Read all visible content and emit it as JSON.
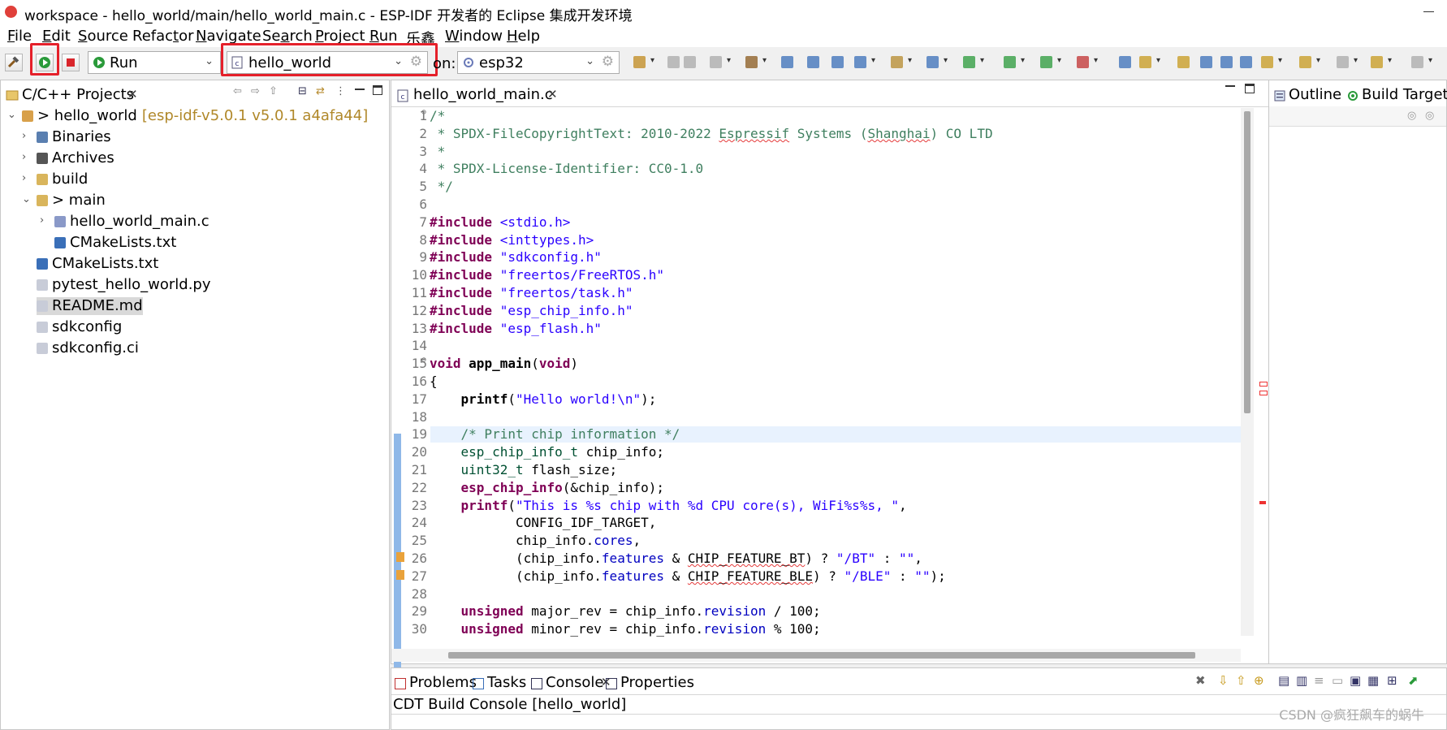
{
  "window": {
    "title": "workspace - hello_world/main/hello_world_main.c - ESP-IDF 开发者的 Eclipse 集成开发环境"
  },
  "menu": [
    {
      "pre": "",
      "u": "F",
      "post": "ile"
    },
    {
      "pre": "",
      "u": "E",
      "post": "dit"
    },
    {
      "pre": "",
      "u": "S",
      "post": "ource"
    },
    {
      "pre": "Refac",
      "u": "t",
      "post": "or"
    },
    {
      "pre": "",
      "u": "N",
      "post": "avigate"
    },
    {
      "pre": "Se",
      "u": "a",
      "post": "rch"
    },
    {
      "pre": "",
      "u": "P",
      "post": "roject"
    },
    {
      "pre": "",
      "u": "R",
      "post": "un"
    },
    {
      "pre": "乐鑫",
      "u": "",
      "post": ""
    },
    {
      "pre": "",
      "u": "W",
      "post": "indow"
    },
    {
      "pre": "",
      "u": "H",
      "post": "elp"
    }
  ],
  "toolbar": {
    "launch_mode": "Run",
    "launch_config": "hello_world",
    "target_label": "on:",
    "target": "esp32"
  },
  "project_explorer": {
    "tab_label": "C/C++ Projects",
    "project_name": "> hello_world",
    "project_decoration": "[esp-idf-v5.0.1 v5.0.1 a4afa44]",
    "items": [
      {
        "label": "Binaries"
      },
      {
        "label": "Archives"
      },
      {
        "label": "build"
      },
      {
        "label": "> main"
      },
      {
        "label": "hello_world_main.c"
      },
      {
        "label": "CMakeLists.txt"
      },
      {
        "label": "CMakeLists.txt"
      },
      {
        "label": "pytest_hello_world.py"
      },
      {
        "label": "README.md"
      },
      {
        "label": "sdkconfig"
      },
      {
        "label": "sdkconfig.ci"
      }
    ]
  },
  "editor": {
    "tab_label": "hello_world_main.c",
    "lines": [
      {
        "n": "1",
        "s": [
          {
            "c": "cm",
            "t": "/*"
          }
        ]
      },
      {
        "n": "2",
        "s": [
          {
            "c": "cm",
            "t": " * SPDX-FileCopyrightText: 2010-2022 "
          },
          {
            "c": "cm sq",
            "t": "Espressif"
          },
          {
            "c": "cm",
            "t": " Systems ("
          },
          {
            "c": "cm sq",
            "t": "Shanghai"
          },
          {
            "c": "cm",
            "t": ") CO LTD"
          }
        ]
      },
      {
        "n": "3",
        "s": [
          {
            "c": "cm",
            "t": " *"
          }
        ]
      },
      {
        "n": "4",
        "s": [
          {
            "c": "cm",
            "t": " * SPDX-License-Identifier: CC0-1.0"
          }
        ]
      },
      {
        "n": "5",
        "s": [
          {
            "c": "cm",
            "t": " */"
          }
        ]
      },
      {
        "n": "6",
        "s": []
      },
      {
        "n": "7",
        "s": [
          {
            "c": "kw",
            "t": "#include"
          },
          {
            "c": "",
            "t": " "
          },
          {
            "c": "st",
            "t": "<stdio.h>"
          }
        ]
      },
      {
        "n": "8",
        "s": [
          {
            "c": "kw",
            "t": "#include"
          },
          {
            "c": "",
            "t": " "
          },
          {
            "c": "st",
            "t": "<inttypes.h>"
          }
        ]
      },
      {
        "n": "9",
        "s": [
          {
            "c": "kw",
            "t": "#include"
          },
          {
            "c": "",
            "t": " "
          },
          {
            "c": "st",
            "t": "\"sdkconfig.h\""
          }
        ]
      },
      {
        "n": "10",
        "s": [
          {
            "c": "kw",
            "t": "#include"
          },
          {
            "c": "",
            "t": " "
          },
          {
            "c": "st",
            "t": "\"freertos/FreeRTOS.h\""
          }
        ]
      },
      {
        "n": "11",
        "s": [
          {
            "c": "kw",
            "t": "#include"
          },
          {
            "c": "",
            "t": " "
          },
          {
            "c": "st",
            "t": "\"freertos/task.h\""
          }
        ]
      },
      {
        "n": "12",
        "s": [
          {
            "c": "kw",
            "t": "#include"
          },
          {
            "c": "",
            "t": " "
          },
          {
            "c": "st",
            "t": "\"esp_chip_info.h\""
          }
        ]
      },
      {
        "n": "13",
        "s": [
          {
            "c": "kw",
            "t": "#include"
          },
          {
            "c": "",
            "t": " "
          },
          {
            "c": "st",
            "t": "\"esp_flash.h\""
          }
        ]
      },
      {
        "n": "14",
        "s": []
      },
      {
        "n": "15",
        "s": [
          {
            "c": "kw",
            "t": "void"
          },
          {
            "c": "",
            "t": " "
          },
          {
            "c": "fn",
            "t": "app_main"
          },
          {
            "c": "",
            "t": "("
          },
          {
            "c": "kw",
            "t": "void"
          },
          {
            "c": "",
            "t": ")"
          }
        ]
      },
      {
        "n": "16",
        "s": [
          {
            "c": "",
            "t": "{"
          }
        ]
      },
      {
        "n": "17",
        "s": [
          {
            "c": "",
            "t": "    "
          },
          {
            "c": "fn kw",
            "t": "printf"
          },
          {
            "c": "",
            "t": "("
          },
          {
            "c": "st",
            "t": "\"Hello world!\\n\""
          },
          {
            "c": "",
            "t": ");"
          }
        ]
      },
      {
        "n": "18",
        "s": []
      },
      {
        "n": "19",
        "s": [
          {
            "c": "",
            "t": "    "
          },
          {
            "c": "cm",
            "t": "/* Print chip information */"
          }
        ]
      },
      {
        "n": "20",
        "s": [
          {
            "c": "",
            "t": "    "
          },
          {
            "c": "ty",
            "t": "esp_chip_info_t"
          },
          {
            "c": "",
            "t": " chip_info;"
          }
        ]
      },
      {
        "n": "21",
        "s": [
          {
            "c": "",
            "t": "    "
          },
          {
            "c": "ty",
            "t": "uint32_t"
          },
          {
            "c": "",
            "t": " flash_size;"
          }
        ]
      },
      {
        "n": "22",
        "s": [
          {
            "c": "",
            "t": "    "
          },
          {
            "c": "kw",
            "t": "esp_chip_info"
          },
          {
            "c": "",
            "t": "(&chip_info);"
          }
        ]
      },
      {
        "n": "23",
        "s": [
          {
            "c": "",
            "t": "    "
          },
          {
            "c": "kw",
            "t": "printf"
          },
          {
            "c": "",
            "t": "("
          },
          {
            "c": "st",
            "t": "\"This is %s chip with %d CPU core(s), WiFi%s%s, \""
          },
          {
            "c": "",
            "t": ","
          }
        ]
      },
      {
        "n": "24",
        "s": [
          {
            "c": "",
            "t": "           CONFIG_IDF_TARGET,"
          }
        ]
      },
      {
        "n": "25",
        "s": [
          {
            "c": "",
            "t": "           chip_info."
          },
          {
            "c": "fld",
            "t": "cores"
          },
          {
            "c": "",
            "t": ","
          }
        ]
      },
      {
        "n": "26",
        "s": [
          {
            "c": "",
            "t": "           (chip_info."
          },
          {
            "c": "fld",
            "t": "features"
          },
          {
            "c": "",
            "t": " & "
          },
          {
            "c": "sq",
            "t": "CHIP_FEATURE_BT"
          },
          {
            "c": "",
            "t": ") ? "
          },
          {
            "c": "st",
            "t": "\"/BT\""
          },
          {
            "c": "",
            "t": " : "
          },
          {
            "c": "st",
            "t": "\"\""
          },
          {
            "c": "",
            "t": ","
          }
        ]
      },
      {
        "n": "27",
        "s": [
          {
            "c": "",
            "t": "           (chip_info."
          },
          {
            "c": "fld",
            "t": "features"
          },
          {
            "c": "",
            "t": " & "
          },
          {
            "c": "sq",
            "t": "CHIP_FEATURE_BLE"
          },
          {
            "c": "",
            "t": ") ? "
          },
          {
            "c": "st",
            "t": "\"/BLE\""
          },
          {
            "c": "",
            "t": " : "
          },
          {
            "c": "st",
            "t": "\"\""
          },
          {
            "c": "",
            "t": ");"
          }
        ]
      },
      {
        "n": "28",
        "s": []
      },
      {
        "n": "29",
        "s": [
          {
            "c": "",
            "t": "    "
          },
          {
            "c": "kw",
            "t": "unsigned"
          },
          {
            "c": "",
            "t": " major_rev = chip_info."
          },
          {
            "c": "fld",
            "t": "revision"
          },
          {
            "c": "",
            "t": " / 100;"
          }
        ]
      },
      {
        "n": "30",
        "s": [
          {
            "c": "",
            "t": "    "
          },
          {
            "c": "kw",
            "t": "unsigned"
          },
          {
            "c": "",
            "t": " minor_rev = chip_info."
          },
          {
            "c": "fld",
            "t": "revision"
          },
          {
            "c": "",
            "t": " % 100;"
          }
        ]
      }
    ]
  },
  "outline": {
    "tab_outline": "Outline",
    "tab_build_targets": "Build Targets"
  },
  "bottom_panel": {
    "tabs": [
      "Problems",
      "Tasks",
      "Console",
      "Properties"
    ],
    "console_title": "CDT Build Console [hello_world]"
  },
  "watermark": "CSDN @疯狂飙车的蜗牛",
  "colors": {
    "highlight_box": "#e5202a",
    "keyword": "#7f0055",
    "comment": "#3f7f5f",
    "string": "#2a00ff"
  }
}
